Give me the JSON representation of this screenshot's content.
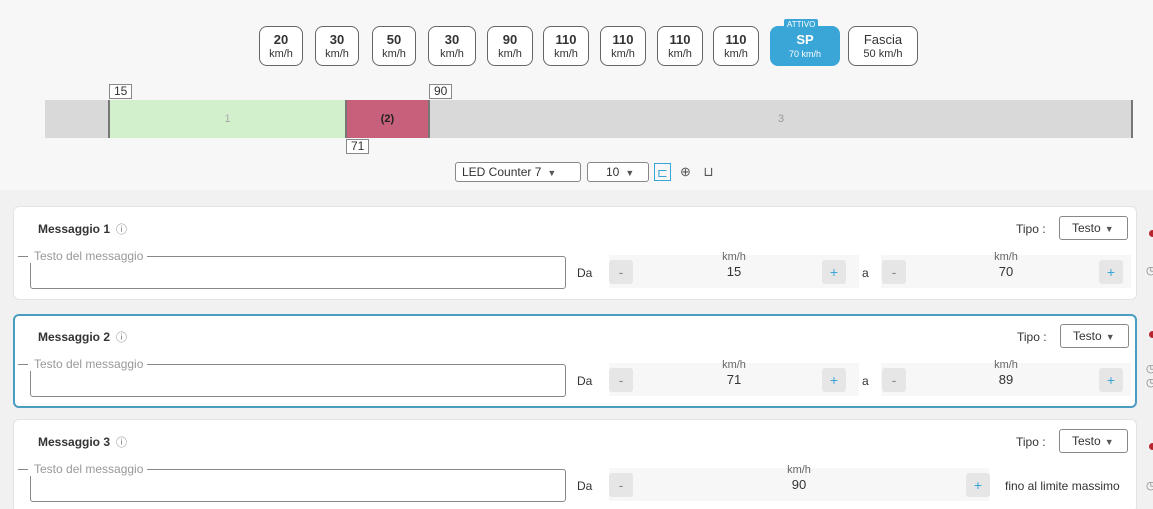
{
  "speed_buttons": [
    {
      "value": "20",
      "unit": "km/h"
    },
    {
      "value": "30",
      "unit": "km/h"
    },
    {
      "value": "50",
      "unit": "km/h"
    },
    {
      "value": "30",
      "unit": "km/h"
    },
    {
      "value": "90",
      "unit": "km/h"
    },
    {
      "value": "110",
      "unit": "km/h"
    },
    {
      "value": "110",
      "unit": "km/h"
    },
    {
      "value": "110",
      "unit": "km/h"
    },
    {
      "value": "110",
      "unit": "km/h"
    },
    {
      "value": "SP",
      "unit": "70 km/h",
      "badge": "ATTIVO"
    },
    {
      "value": "Fascia",
      "unit": "50 km/h"
    }
  ],
  "timeline": {
    "markers": [
      "15",
      "90",
      "71"
    ],
    "segments": [
      "1",
      "(2)",
      "3"
    ],
    "colors": {
      "seg1": "#d3f0cd",
      "seg2": "#c7607a",
      "rest": "#d9d9d9"
    }
  },
  "controls": {
    "counter_select": "LED Counter 7",
    "size_select": "10",
    "align_icons": [
      "align-left-icon",
      "align-center-icon",
      "align-bottom-icon"
    ]
  },
  "messages": [
    {
      "title": "Messaggio 1",
      "tipo_label": "Tipo :",
      "tipo": "Testo",
      "placeholder": "Testo del messaggio",
      "da": "Da",
      "from_unit": "km/h",
      "from_value": "15",
      "a": "a",
      "to_unit": "km/h",
      "to_value": "70"
    },
    {
      "title": "Messaggio 2",
      "tipo_label": "Tipo :",
      "tipo": "Testo",
      "placeholder": "Testo del messaggio",
      "da": "Da",
      "from_unit": "km/h",
      "from_value": "71",
      "a": "a",
      "to_unit": "km/h",
      "to_value": "89"
    },
    {
      "title": "Messaggio 3",
      "tipo_label": "Tipo :",
      "tipo": "Testo",
      "placeholder": "Testo del messaggio",
      "da": "Da",
      "from_unit": "km/h",
      "from_value": "90",
      "to_text": "fino al limite massimo"
    }
  ],
  "accent_color": "#3aa6d8"
}
